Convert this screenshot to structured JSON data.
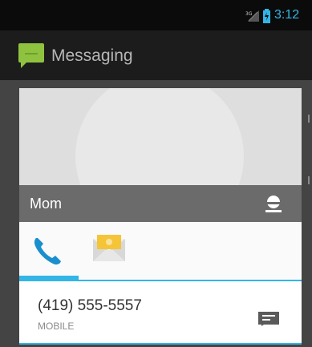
{
  "status_bar": {
    "time": "3:12",
    "signal_icon": "signal-no-service-icon",
    "battery_icon": "battery-charging-icon",
    "accent_color": "#33b5e5"
  },
  "action_bar": {
    "title": "Messaging",
    "app_icon": "messaging-app-icon"
  },
  "contact_card": {
    "name": "Mom",
    "photo_icon": "contact-photo-placeholder",
    "contact_icon": "contact-person-icon",
    "tabs": [
      {
        "id": "phone",
        "icon": "phone-icon",
        "selected": true
      },
      {
        "id": "email",
        "icon": "email-icon",
        "selected": false
      }
    ],
    "phone": {
      "number": "(419) 555-5557",
      "type": "MOBILE",
      "action_icon": "send-message-icon"
    }
  }
}
